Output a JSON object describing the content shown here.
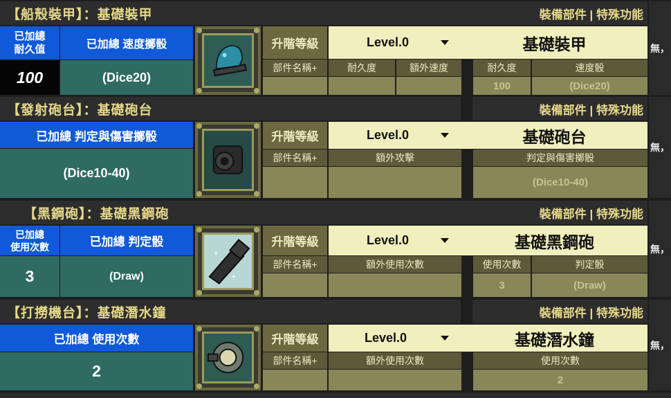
{
  "common": {
    "equip_links": "裝備部件 | 特殊功能",
    "upgrade_label": "升階等級",
    "part_name_label": "部件名稱+",
    "side_text": "無，"
  },
  "sections": [
    {
      "title": "【船殼裝甲】：基礎裝甲",
      "left_label_1": "已加總\n耐久值",
      "left_label_2": "已加總  速度擲骰",
      "left_value_1": "100",
      "left_value_2": "(Dice20)",
      "level": "Level.0",
      "part_name": "基礎裝甲",
      "extra_col_1": "耐久度",
      "extra_col_2": "額外速度",
      "stat_col_1": "耐久度",
      "stat_col_2": "速度骰",
      "stat_val_1": "100",
      "stat_val_2": "(Dice20)",
      "icon": "armor-helmet-icon"
    },
    {
      "title": "【發射砲台】：基礎砲台",
      "left_label_2": "已加總  判定與傷害擲骰",
      "left_value_2": "(Dice10-40)",
      "level": "Level.0",
      "part_name": "基礎砲台",
      "extra_col_1": "額外攻擊",
      "stat_col_1": "判定與傷害擲骰",
      "stat_val_1": "(Dice10-40)",
      "icon": "cannon-icon"
    },
    {
      "title": "【黑鋼砲】：基礎黑鋼砲",
      "left_label_1": "已加總\n使用次數",
      "left_label_2": "已加總   判定骰",
      "left_value_1": "3",
      "left_value_2": "(Draw)",
      "level": "Level.0",
      "part_name": "基礎黑鋼砲",
      "extra_col_1": "額外使用次數",
      "stat_col_1": "使用次數",
      "stat_col_2": "判定骰",
      "stat_val_1": "3",
      "stat_val_2": "(Draw)",
      "icon": "black-steel-cannon-icon"
    },
    {
      "title": "【打撈機台】：基礎潛水鐘",
      "left_label_2": "已加總  使用次數",
      "left_value_2": "2",
      "level": "Level.0",
      "part_name": "基礎潛水鐘",
      "extra_col_1": "額外使用次數",
      "stat_col_1": "使用次數",
      "stat_val_1": "2",
      "icon": "diving-bell-icon"
    }
  ]
}
